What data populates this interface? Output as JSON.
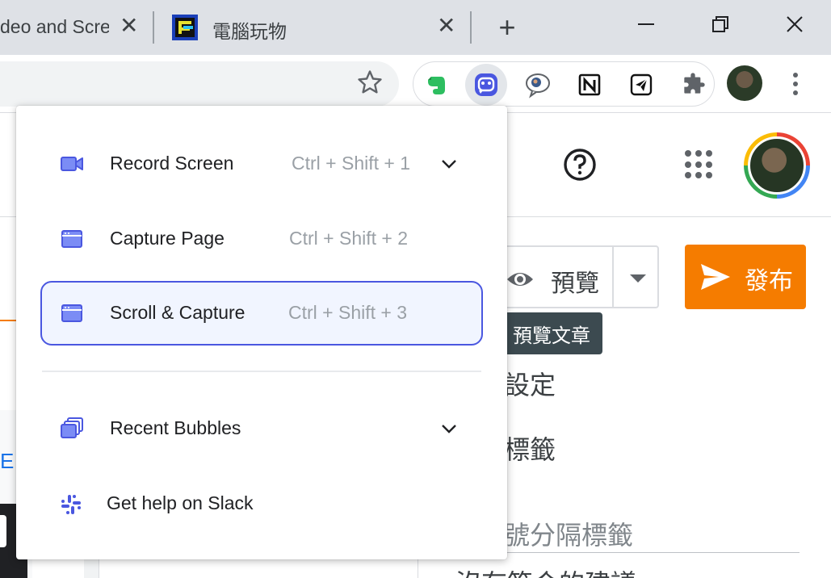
{
  "browser": {
    "tabs": [
      {
        "title": "deo and Scre",
        "active": false
      },
      {
        "title": "電腦玩物",
        "active": false
      }
    ],
    "new_tab_label": "+",
    "window_controls": [
      "minimize-icon",
      "restore-icon",
      "close-icon"
    ],
    "extensions": [
      "evernote-icon",
      "awesome-screenshot-icon",
      "speech-bubble-icon",
      "notion-icon",
      "telegram-icon",
      "puzzle-icon"
    ]
  },
  "page": {
    "preview_label": "預覽",
    "publish_label": "發布",
    "tooltip": "預覽文章",
    "settings_label": "設定",
    "tags_label": "標籤",
    "tags_placeholder": "號分隔標籤",
    "no_match_label": "沒有符合的建議",
    "left_glyph": "E"
  },
  "popup": {
    "items": [
      {
        "label": "Record Screen",
        "shortcut": "Ctrl + Shift + 1",
        "icon": "camera-icon",
        "has_chevron": true
      },
      {
        "label": "Capture Page",
        "shortcut": "Ctrl + Shift + 2",
        "icon": "browser-window-icon",
        "has_chevron": false
      },
      {
        "label": "Scroll & Capture",
        "shortcut": "Ctrl + Shift + 3",
        "icon": "browser-window-icon",
        "has_chevron": false,
        "selected": true
      },
      {
        "label": "Recent Bubbles",
        "icon": "stacked-windows-icon",
        "has_chevron": true
      },
      {
        "label": "Get help on Slack",
        "icon": "slack-icon",
        "has_chevron": false
      }
    ]
  },
  "colors": {
    "accent": "#4a57e0",
    "icon_fill": "#7b8cf5",
    "publish": "#f57c00",
    "tooltip_bg": "#3c4a50"
  }
}
